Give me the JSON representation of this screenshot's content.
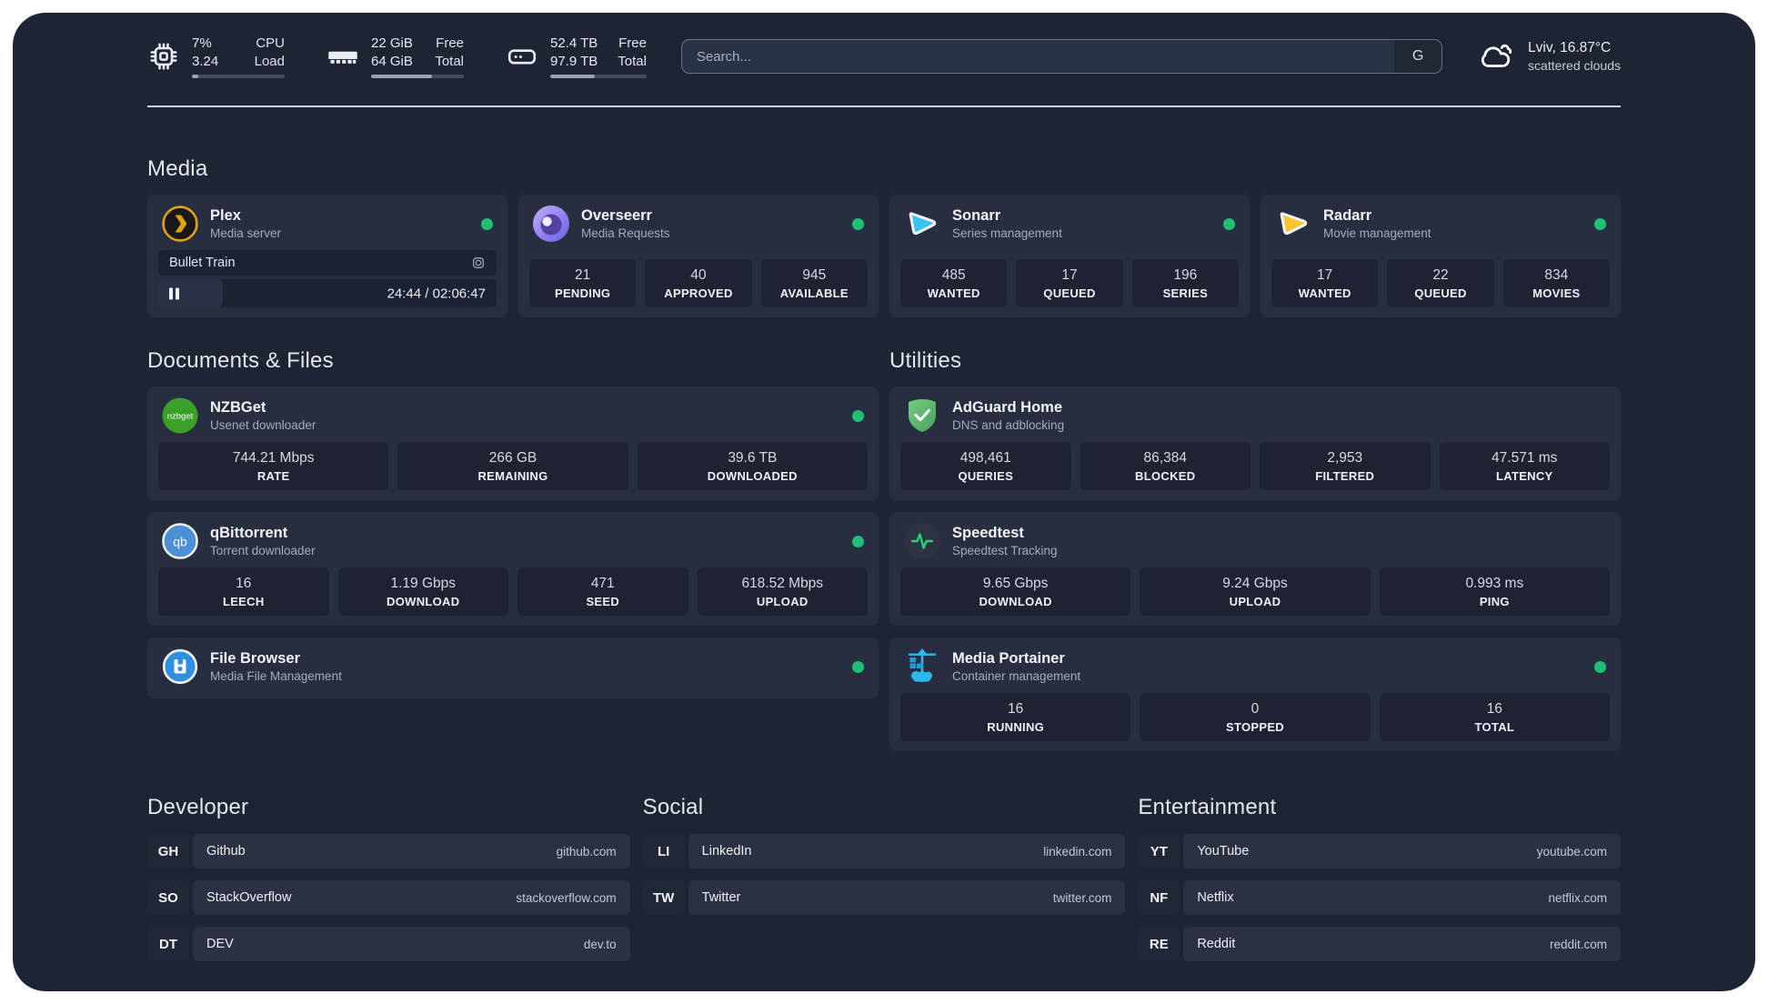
{
  "topbar": {
    "cpu": {
      "usage": "7%",
      "load": "3.24",
      "label_top": "CPU",
      "label_bottom": "Load",
      "progress_percent": 7
    },
    "memory": {
      "free": "22 GiB",
      "total": "64 GiB",
      "label_top": "Free",
      "label_bottom": "Total",
      "progress_percent": 66
    },
    "disk": {
      "free": "52.4 TB",
      "total": "97.9 TB",
      "label_top": "Free",
      "label_bottom": "Total",
      "progress_percent": 46
    },
    "search": {
      "placeholder": "Search...",
      "provider_button": "G"
    },
    "weather": {
      "location_temperature": "Lviv, 16.87°C",
      "condition": "scattered clouds"
    }
  },
  "media": {
    "title": "Media",
    "services": [
      {
        "name": "Plex",
        "subtitle": "Media server",
        "online": true,
        "now_playing": {
          "title": "Bullet Train",
          "time": "24:44 / 02:06:47",
          "progress_percent": 19
        }
      },
      {
        "name": "Overseerr",
        "subtitle": "Media Requests",
        "online": true,
        "stats": [
          {
            "value": "21",
            "label": "PENDING"
          },
          {
            "value": "40",
            "label": "APPROVED"
          },
          {
            "value": "945",
            "label": "AVAILABLE"
          }
        ]
      },
      {
        "name": "Sonarr",
        "subtitle": "Series management",
        "online": true,
        "stats": [
          {
            "value": "485",
            "label": "WANTED"
          },
          {
            "value": "17",
            "label": "QUEUED"
          },
          {
            "value": "196",
            "label": "SERIES"
          }
        ]
      },
      {
        "name": "Radarr",
        "subtitle": "Movie management",
        "online": true,
        "stats": [
          {
            "value": "17",
            "label": "WANTED"
          },
          {
            "value": "22",
            "label": "QUEUED"
          },
          {
            "value": "834",
            "label": "MOVIES"
          }
        ]
      }
    ]
  },
  "documents_files": {
    "title": "Documents & Files",
    "services": [
      {
        "name": "NZBGet",
        "subtitle": "Usenet downloader",
        "online": true,
        "stats": [
          {
            "value": "744.21 Mbps",
            "label": "RATE"
          },
          {
            "value": "266 GB",
            "label": "REMAINING"
          },
          {
            "value": "39.6 TB",
            "label": "DOWNLOADED"
          }
        ]
      },
      {
        "name": "qBittorrent",
        "subtitle": "Torrent downloader",
        "online": true,
        "stats": [
          {
            "value": "16",
            "label": "LEECH"
          },
          {
            "value": "1.19 Gbps",
            "label": "DOWNLOAD"
          },
          {
            "value": "471",
            "label": "SEED"
          },
          {
            "value": "618.52 Mbps",
            "label": "UPLOAD"
          }
        ]
      },
      {
        "name": "File Browser",
        "subtitle": "Media File Management",
        "online": true
      }
    ]
  },
  "utilities": {
    "title": "Utilities",
    "services": [
      {
        "name": "AdGuard Home",
        "subtitle": "DNS and adblocking",
        "stats": [
          {
            "value": "498,461",
            "label": "QUERIES"
          },
          {
            "value": "86,384",
            "label": "BLOCKED"
          },
          {
            "value": "2,953",
            "label": "FILTERED"
          },
          {
            "value": "47.571 ms",
            "label": "LATENCY"
          }
        ]
      },
      {
        "name": "Speedtest",
        "subtitle": "Speedtest Tracking",
        "stats": [
          {
            "value": "9.65 Gbps",
            "label": "DOWNLOAD"
          },
          {
            "value": "9.24 Gbps",
            "label": "UPLOAD"
          },
          {
            "value": "0.993 ms",
            "label": "PING"
          }
        ]
      },
      {
        "name": "Media Portainer",
        "subtitle": "Container management",
        "online": true,
        "stats": [
          {
            "value": "16",
            "label": "RUNNING"
          },
          {
            "value": "0",
            "label": "STOPPED"
          },
          {
            "value": "16",
            "label": "TOTAL"
          }
        ]
      }
    ]
  },
  "bookmarks": [
    {
      "title": "Developer",
      "links": [
        {
          "abbr": "GH",
          "name": "Github",
          "domain": "github.com"
        },
        {
          "abbr": "SO",
          "name": "StackOverflow",
          "domain": "stackoverflow.com"
        },
        {
          "abbr": "DT",
          "name": "DEV",
          "domain": "dev.to"
        }
      ]
    },
    {
      "title": "Social",
      "links": [
        {
          "abbr": "LI",
          "name": "LinkedIn",
          "domain": "linkedin.com"
        },
        {
          "abbr": "TW",
          "name": "Twitter",
          "domain": "twitter.com"
        }
      ]
    },
    {
      "title": "Entertainment",
      "links": [
        {
          "abbr": "YT",
          "name": "YouTube",
          "domain": "youtube.com"
        },
        {
          "abbr": "NF",
          "name": "Netflix",
          "domain": "netflix.com"
        },
        {
          "abbr": "RE",
          "name": "Reddit",
          "domain": "reddit.com"
        }
      ]
    }
  ],
  "icons": {
    "topbar": [
      "cpu-chip-icon",
      "ram-icon",
      "disk-icon",
      "cloud-icon"
    ],
    "services": [
      "plex-icon",
      "overseerr-icon",
      "sonarr-icon",
      "radarr-icon",
      "nzbget-icon",
      "qbittorrent-icon",
      "filebrowser-icon",
      "adguard-icon",
      "speedtest-icon",
      "portainer-icon"
    ]
  },
  "colors": {
    "page_background": "#1d2434",
    "card": "#272e40",
    "stat_box": "#1d2333",
    "status_green": "#1fbf75",
    "plex_amber": "#e5a00d",
    "sonarr_blue": "#35c5f4",
    "radarr_amber": "#ffc230",
    "nzbget_green": "#3ba028",
    "qbittorrent_blue": "#4b8fd4",
    "adguard_green": "#5cb874",
    "speedtest_green": "#24d17e",
    "portainer_blue": "#2bb8ea",
    "divider": "#ccd2da"
  }
}
